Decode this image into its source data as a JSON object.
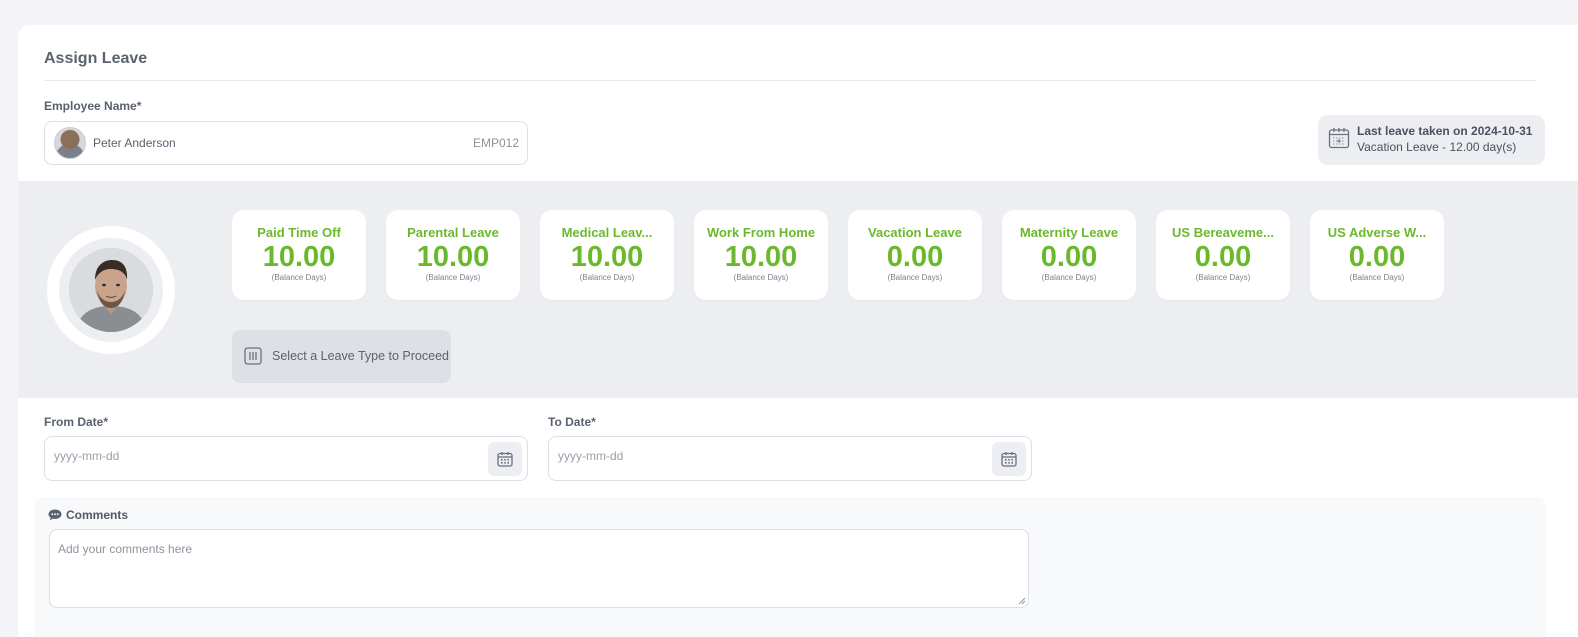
{
  "form": {
    "title": "Assign Leave",
    "employee_label": "Employee Name*",
    "employee_name": "Peter Anderson",
    "employee_code": "EMP012"
  },
  "last_leave": {
    "line1": "Last leave taken on 2024-10-31",
    "line2": "Vacation Leave - 12.00 day(s)",
    "icon": "calendar-icon"
  },
  "leave_types": [
    {
      "name": "Paid Time Off",
      "value": "10.00",
      "sub": "(Balance Days)"
    },
    {
      "name": "Parental Leave",
      "value": "10.00",
      "sub": "(Balance Days)"
    },
    {
      "name": "Medical Leav...",
      "value": "10.00",
      "sub": "(Balance Days)"
    },
    {
      "name": "Work From Home",
      "value": "10.00",
      "sub": "(Balance Days)"
    },
    {
      "name": "Vacation Leave",
      "value": "0.00",
      "sub": "(Balance Days)"
    },
    {
      "name": "Maternity Leave",
      "value": "0.00",
      "sub": "(Balance Days)"
    },
    {
      "name": "US Bereaveme...",
      "value": "0.00",
      "sub": "(Balance Days)"
    },
    {
      "name": "US Adverse W...",
      "value": "0.00",
      "sub": "(Balance Days)"
    }
  ],
  "select_hint": {
    "text": "Select a Leave Type to Proceed",
    "icon": "columns-icon"
  },
  "dates": {
    "from_label": "From Date*",
    "from_placeholder": "yyyy-mm-dd",
    "to_label": "To Date*",
    "to_placeholder": "yyyy-mm-dd"
  },
  "comments": {
    "label": "Comments",
    "placeholder": "Add your comments here",
    "icon": "chat-icon"
  },
  "colors": {
    "accent_green": "#6bb82c",
    "panel_gray": "#eceef1",
    "page_bg": "#f4f4f8"
  }
}
